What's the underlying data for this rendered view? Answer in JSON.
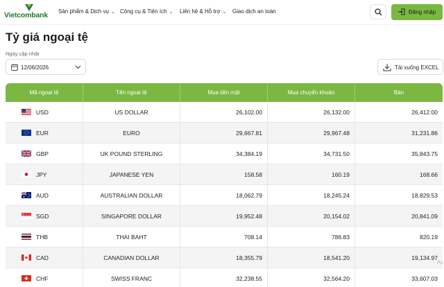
{
  "brand": {
    "name": "Vietcombank",
    "color": "#1e7a2e"
  },
  "nav": [
    {
      "label": "Sản phẩm & Dịch vụ",
      "has_dropdown": true
    },
    {
      "label": "Công cụ & Tiện ích",
      "has_dropdown": true
    },
    {
      "label": "Liên hệ & Hỗ trợ",
      "has_dropdown": true
    },
    {
      "label": "Giao dịch an toàn",
      "has_dropdown": false
    }
  ],
  "header": {
    "search_icon": "search-icon",
    "login_label": "Đăng nhập",
    "login_icon": "login-icon",
    "accent": "#7ab842"
  },
  "page": {
    "title": "Tỷ giá ngoại tệ",
    "updated_label": "Ngày cập nhật",
    "date_value": "12/06/2026",
    "download_label": "Tải xuống EXCEL"
  },
  "table": {
    "columns": [
      "Mã ngoại tệ",
      "Tên ngoại tệ",
      "Mua tiền mặt",
      "Mua chuyển khoản",
      "Bán"
    ],
    "rows": [
      {
        "code": "USD",
        "name": "US DOLLAR",
        "cash": "26,102.00",
        "transfer": "26,132.00",
        "sell": "26,412.00",
        "flag": "us-flag"
      },
      {
        "code": "EUR",
        "name": "EURO",
        "cash": "29,667.81",
        "transfer": "29,967.48",
        "sell": "31,231.86",
        "flag": "eu-flag"
      },
      {
        "code": "GBP",
        "name": "UK POUND STERLING",
        "cash": "34,384.19",
        "transfer": "34,731.50",
        "sell": "35,843.75",
        "flag": "uk-flag"
      },
      {
        "code": "JPY",
        "name": "JAPANESE YEN",
        "cash": "158.58",
        "transfer": "160.19",
        "sell": "168.66",
        "flag": "jp-flag"
      },
      {
        "code": "AUD",
        "name": "AUSTRALIAN DOLLAR",
        "cash": "18,062.79",
        "transfer": "18,245.24",
        "sell": "18,829.53",
        "flag": "au-flag"
      },
      {
        "code": "SGD",
        "name": "SINGAPORE DOLLAR",
        "cash": "19,952.48",
        "transfer": "20,154.02",
        "sell": "20,841.09",
        "flag": "sg-flag"
      },
      {
        "code": "THB",
        "name": "THAI BAHT",
        "cash": "708.14",
        "transfer": "786.83",
        "sell": "820.19",
        "flag": "th-flag"
      },
      {
        "code": "CAD",
        "name": "CANADIAN DOLLAR",
        "cash": "18,355.79",
        "transfer": "18,541.20",
        "sell": "19,134.97",
        "flag": "ca-flag"
      },
      {
        "code": "CHF",
        "name": "SWISS FRANC",
        "cash": "32,238.55",
        "transfer": "32,564.20",
        "sell": "33,607.03",
        "flag": "ch-flag"
      }
    ]
  },
  "overlay": {
    "watermark_text": "Ac"
  }
}
